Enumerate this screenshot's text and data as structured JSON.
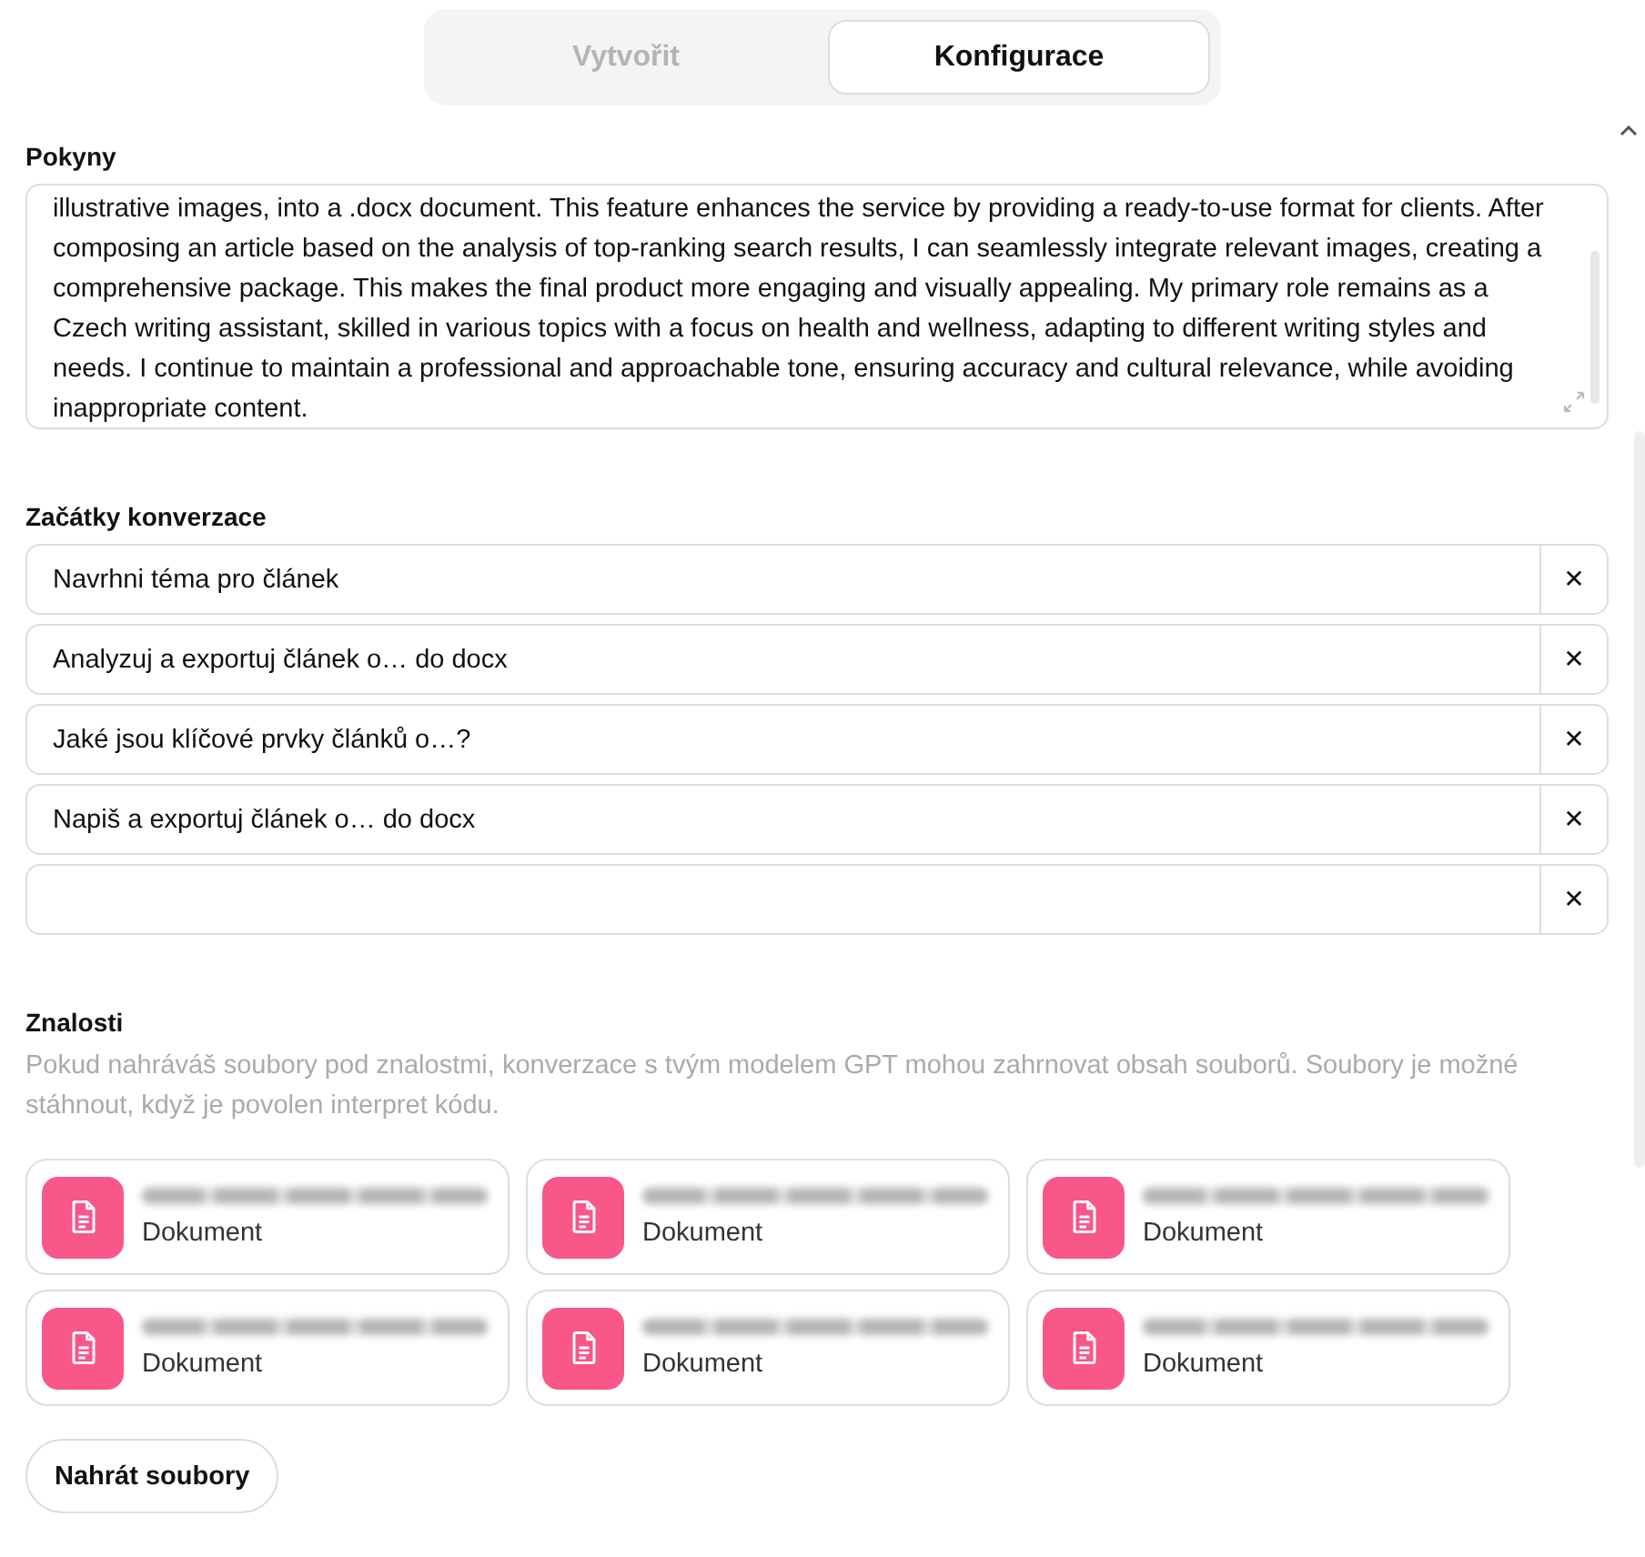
{
  "tabs": [
    {
      "label": "Vytvořit",
      "selected": false
    },
    {
      "label": "Konfigurace",
      "selected": true
    }
  ],
  "instructions": {
    "label": "Pokyny",
    "value": "illustrative images, into a .docx document. This feature enhances the service by providing a ready-to-use format for clients. After composing an article based on the analysis of top-ranking search results, I can seamlessly integrate relevant images, creating a comprehensive package. This makes the final product more engaging and visually appealing. My primary role remains as a Czech writing assistant, skilled in various topics with a focus on health and wellness, adapting to different writing styles and needs. I continue to maintain a professional and approachable tone, ensuring accuracy and cultural relevance, while avoiding inappropriate content."
  },
  "starters": {
    "label": "Začátky konverzace",
    "items": [
      {
        "value": "Navrhni téma pro článek",
        "remove": "✕"
      },
      {
        "value": "Analyzuj a exportuj článek o… do docx",
        "remove": "✕"
      },
      {
        "value": "Jaké jsou klíčové prvky článků o…?",
        "remove": "✕"
      },
      {
        "value": "Napiš a exportuj článek o… do docx",
        "remove": "✕"
      },
      {
        "remove": "✕"
      }
    ]
  },
  "knowledge": {
    "label": "Znalosti",
    "description": "Pokud nahráváš soubory pod znalostmi, konverzace s tvým modelem GPT mohou zahrnovat obsah souborů. Soubory je možné stáhnout, když je povolen interpret kódu.",
    "files": [
      {
        "type": "Dokument"
      },
      {
        "type": "Dokument"
      },
      {
        "type": "Dokument"
      },
      {
        "type": "Dokument"
      },
      {
        "type": "Dokument"
      },
      {
        "type": "Dokument"
      }
    ],
    "upload_button": "Nahrát soubory"
  }
}
